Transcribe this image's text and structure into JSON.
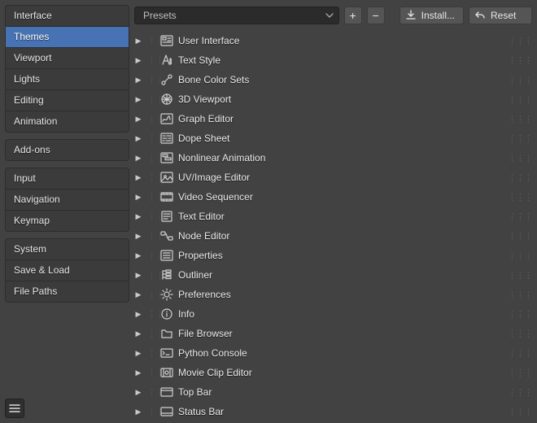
{
  "sidebar": {
    "groups": [
      {
        "items": [
          {
            "label": "Interface",
            "active": false
          },
          {
            "label": "Themes",
            "active": true
          },
          {
            "label": "Viewport",
            "active": false
          },
          {
            "label": "Lights",
            "active": false
          },
          {
            "label": "Editing",
            "active": false
          },
          {
            "label": "Animation",
            "active": false
          }
        ]
      },
      {
        "items": [
          {
            "label": "Add-ons",
            "active": false
          }
        ]
      },
      {
        "items": [
          {
            "label": "Input",
            "active": false
          },
          {
            "label": "Navigation",
            "active": false
          },
          {
            "label": "Keymap",
            "active": false
          }
        ]
      },
      {
        "items": [
          {
            "label": "System",
            "active": false
          },
          {
            "label": "Save & Load",
            "active": false
          },
          {
            "label": "File Paths",
            "active": false
          }
        ]
      }
    ]
  },
  "topbar": {
    "presets_label": "Presets",
    "add": "+",
    "remove": "−",
    "install": "Install...",
    "reset": "Reset"
  },
  "themes": [
    {
      "icon": "ui",
      "label": "User Interface"
    },
    {
      "icon": "text-style",
      "label": "Text Style"
    },
    {
      "icon": "bone",
      "label": "Bone Color Sets"
    },
    {
      "icon": "view3d",
      "label": "3D Viewport"
    },
    {
      "icon": "graph",
      "label": "Graph Editor"
    },
    {
      "icon": "dope",
      "label": "Dope Sheet"
    },
    {
      "icon": "nla",
      "label": "Nonlinear Animation"
    },
    {
      "icon": "uv",
      "label": "UV/Image Editor"
    },
    {
      "icon": "vse",
      "label": "Video Sequencer"
    },
    {
      "icon": "texteditor",
      "label": "Text Editor"
    },
    {
      "icon": "node",
      "label": "Node Editor"
    },
    {
      "icon": "props",
      "label": "Properties"
    },
    {
      "icon": "outliner",
      "label": "Outliner"
    },
    {
      "icon": "prefs",
      "label": "Preferences"
    },
    {
      "icon": "info",
      "label": "Info"
    },
    {
      "icon": "filebrowser",
      "label": "File Browser"
    },
    {
      "icon": "python",
      "label": "Python Console"
    },
    {
      "icon": "clip",
      "label": "Movie Clip Editor"
    },
    {
      "icon": "topbar",
      "label": "Top Bar"
    },
    {
      "icon": "statusbar",
      "label": "Status Bar"
    }
  ]
}
